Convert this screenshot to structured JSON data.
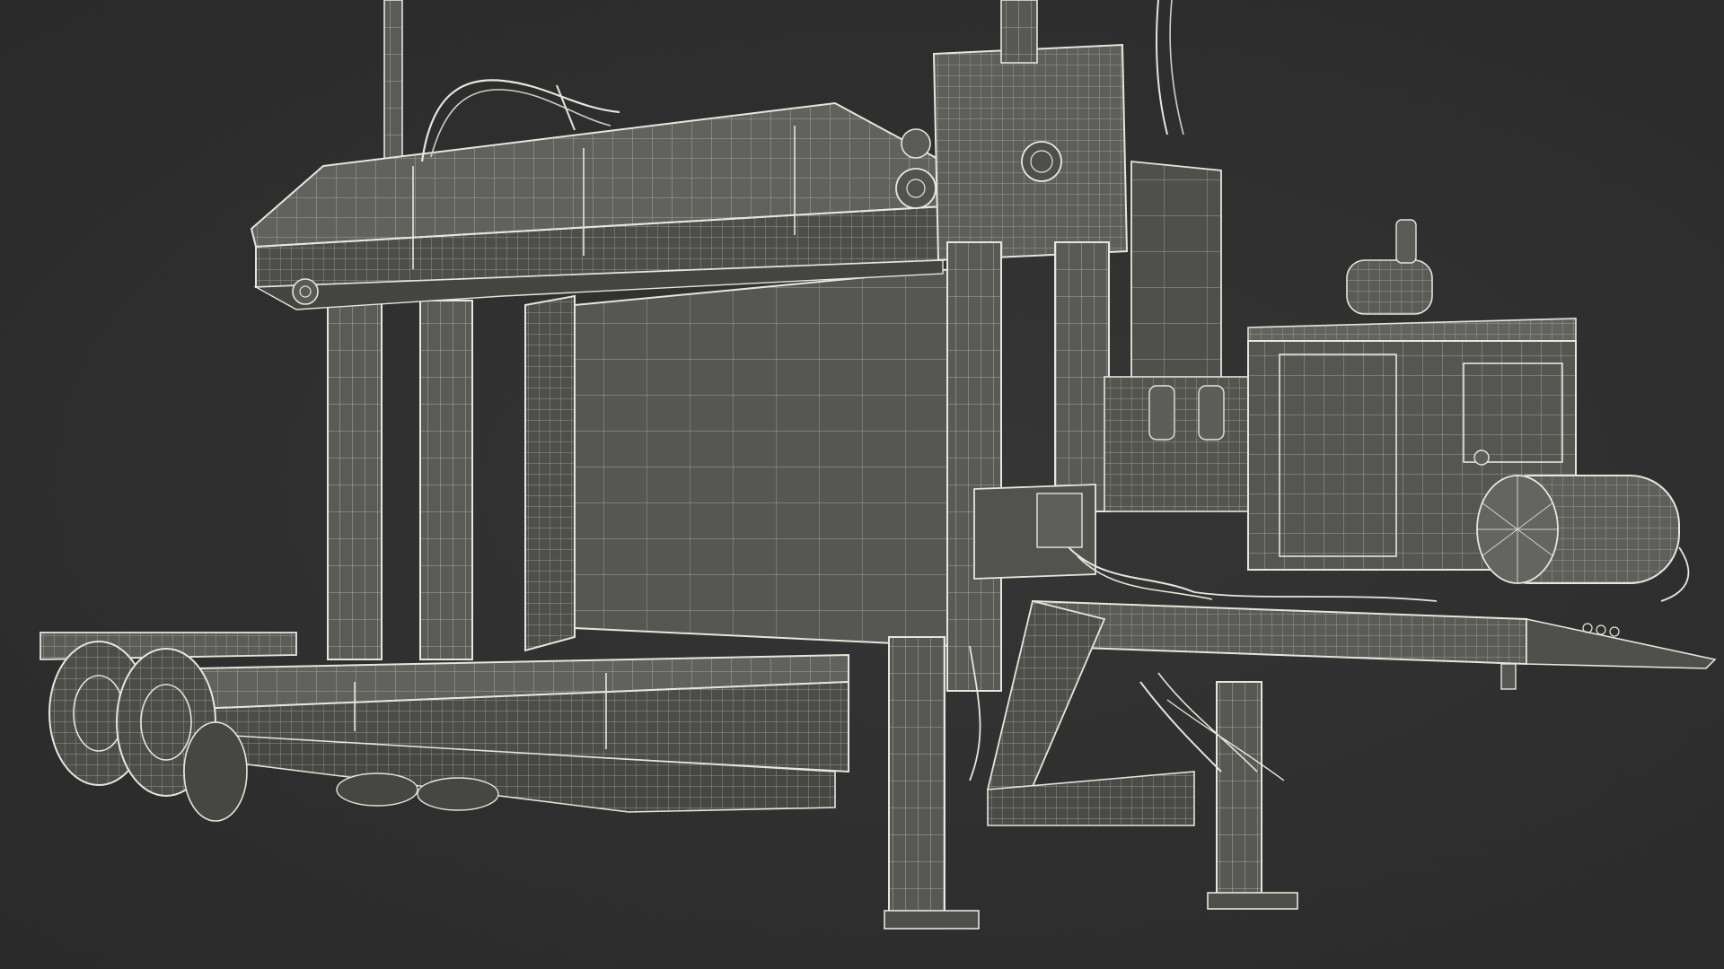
{
  "scene": {
    "subject": "trailer-mounted-press-wireframe",
    "colors": {
      "background": "#2f2f2f",
      "fill": "#5b5b58",
      "fill_dark": "#484846",
      "fill_light": "#6a6a66",
      "wire": "#e6e6dc",
      "wire_soft": "#cfcfc4"
    }
  }
}
